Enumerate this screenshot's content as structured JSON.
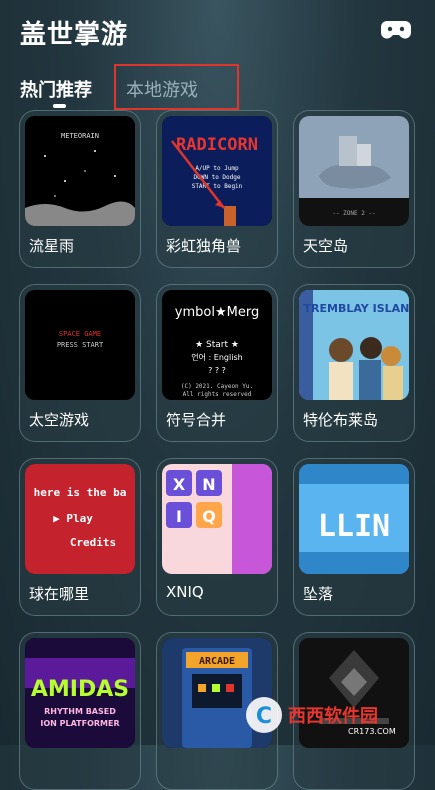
{
  "app": {
    "title": "盖世掌游",
    "icon": "gamepad-icon"
  },
  "tabs": [
    {
      "label": "热门推荐",
      "active": true
    },
    {
      "label": "本地游戏",
      "active": false
    }
  ],
  "accent_color": "#e0352b",
  "games": [
    {
      "name": "流星雨",
      "thumb_text": "METEORAIN"
    },
    {
      "name": "彩虹独角兽",
      "thumb_title": "RADICORN",
      "thumb_lines": [
        "A/UP to Jump",
        "DOWN to Dodge",
        "START to Begin"
      ]
    },
    {
      "name": "天空岛",
      "thumb_text": "-- ZONE 2 --"
    },
    {
      "name": "太空游戏",
      "thumb_lines": [
        "SPACE GAME",
        "PRESS START"
      ]
    },
    {
      "name": "符号合并",
      "thumb_title": "ymbol★Merg",
      "thumb_lines": [
        "★ Start ★",
        "언어 : English",
        "? ? ?",
        "(C) 2021. Cayeon Yu.",
        "All rights reserved"
      ]
    },
    {
      "name": "特伦布莱岛",
      "thumb_title": "TREMBLAY ISLAND"
    },
    {
      "name": "球在哪里",
      "thumb_lines": [
        "here is the ba",
        "▶ Play",
        "Credits"
      ]
    },
    {
      "name": "XNIQ",
      "thumb_lines": [
        "X",
        "N",
        "I",
        "Q"
      ]
    },
    {
      "name": "坠落",
      "thumb_text": "LLIN"
    },
    {
      "name": "",
      "thumb_title": "AMIDAS",
      "thumb_lines": [
        "RHYTHM BASED",
        "ION PLATFORMER"
      ]
    },
    {
      "name": "",
      "thumb_title": "ARCADE"
    },
    {
      "name": ""
    }
  ],
  "watermark": {
    "brand": "西西软件园",
    "url": "CR173.COM"
  }
}
